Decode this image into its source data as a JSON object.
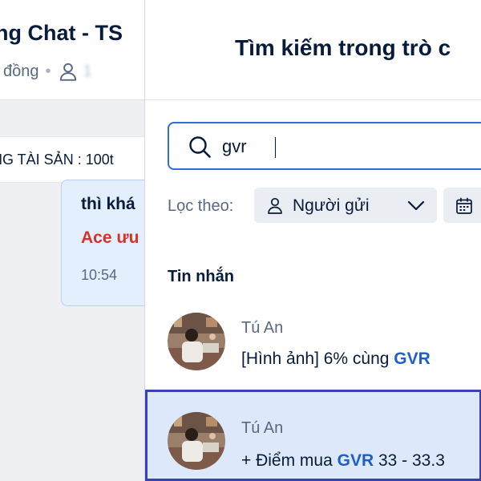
{
  "chat": {
    "title": "ng Chat - TS",
    "subtitle_part": "đồng",
    "pinned_text": "NG TÀI SẢN : 100t",
    "message": {
      "line1": "thì khá",
      "line2": "Ace ưu",
      "time": "10:54"
    }
  },
  "search_panel": {
    "title": "Tìm kiếm trong trò c",
    "search": {
      "value": "gvr",
      "icon": "search-icon"
    },
    "filter": {
      "label": "Lọc theo:",
      "sender_chip": "Người gửi",
      "sender_icon": "person-icon",
      "dropdown_icon": "chevron-down-icon",
      "date_icon": "calendar-icon"
    },
    "section_title": "Tin nhắn",
    "results": [
      {
        "sender": "Tú An",
        "snippet_before": "[Hình ảnh] 6% cùng ",
        "snippet_highlight": "GVR",
        "snippet_after": ""
      },
      {
        "sender": "Tú An",
        "snippet_before": "+ Điểm mua ",
        "snippet_highlight": "GVR",
        "snippet_after": " 33 - 33.3"
      }
    ]
  },
  "colors": {
    "accent": "#2f6ed8",
    "highlight_text": "#1f5fc9",
    "selected_bg": "#dde9fb",
    "selected_border": "#3a41b3",
    "alert_text": "#d8312b"
  }
}
